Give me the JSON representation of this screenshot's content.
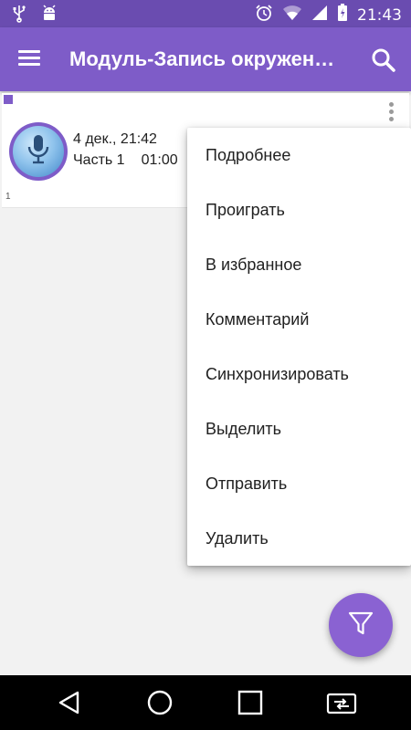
{
  "status_bar": {
    "time": "21:43",
    "icons": [
      "usb-icon",
      "android-debug-icon",
      "alarm-icon",
      "wifi-icon",
      "signal-icon",
      "battery-icon"
    ]
  },
  "app_bar": {
    "title": "Модуль-Запись окружен…",
    "icons": [
      "menu-icon",
      "search-icon"
    ]
  },
  "recording": {
    "date": "4 дек., 21:42",
    "part": "Часть 1",
    "duration": "01:00",
    "note": "1"
  },
  "popup_menu": {
    "items": [
      {
        "label": "Подробнее"
      },
      {
        "label": "Проиграть"
      },
      {
        "label": "В избранное"
      },
      {
        "label": "Комментарий"
      },
      {
        "label": "Синхронизировать"
      },
      {
        "label": "Выделить"
      },
      {
        "label": "Отправить"
      },
      {
        "label": "Удалить"
      }
    ]
  },
  "fab": {
    "icon": "filter-icon"
  },
  "nav_bar": {
    "icons": [
      "back-icon",
      "home-icon",
      "recents-icon",
      "screen-switch-icon"
    ]
  },
  "colors": {
    "status_bar": "#6a4cb0",
    "app_bar": "#7e5cc8",
    "fab": "#8a62d2",
    "nav_bar": "#000000"
  }
}
